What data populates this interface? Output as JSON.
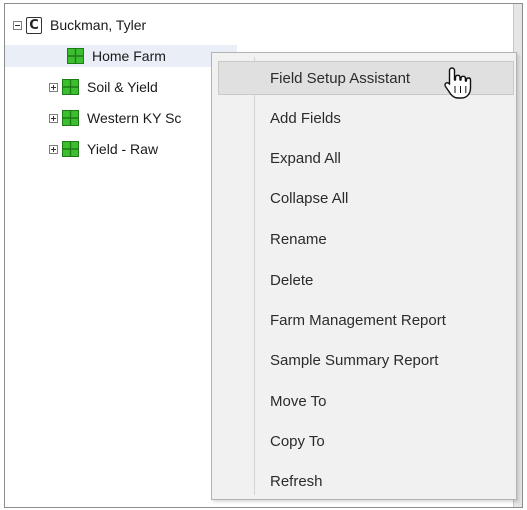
{
  "tree": {
    "root": {
      "label": "Buckman, Tyler",
      "icon": "client-icon",
      "icon_letter": "C"
    },
    "children": [
      {
        "label": "Home Farm",
        "icon": "farm-icon",
        "selected": true
      },
      {
        "label": "Soil & Yield",
        "icon": "farm-icon"
      },
      {
        "label": "Western KY Sc",
        "icon": "farm-icon"
      },
      {
        "label": "Yield - Raw",
        "icon": "farm-icon"
      }
    ]
  },
  "context_menu": {
    "items": [
      {
        "label": "Field Setup Assistant",
        "hovered": true
      },
      {
        "label": "Add Fields"
      },
      {
        "label": "Expand All"
      },
      {
        "label": "Collapse All"
      },
      {
        "label": "Rename"
      },
      {
        "label": "Delete"
      },
      {
        "label": "Farm Management Report"
      },
      {
        "label": "Sample Summary Report"
      },
      {
        "label": "Move To"
      },
      {
        "label": "Copy To"
      },
      {
        "label": "Refresh"
      }
    ]
  },
  "colors": {
    "farm_icon_green": "#3cbf2f",
    "selection_bg": "#e9eef7",
    "menu_bg": "#f1f1f1",
    "menu_hover_bg": "#e0e0e0"
  },
  "cursor": "hand-pointer-icon"
}
